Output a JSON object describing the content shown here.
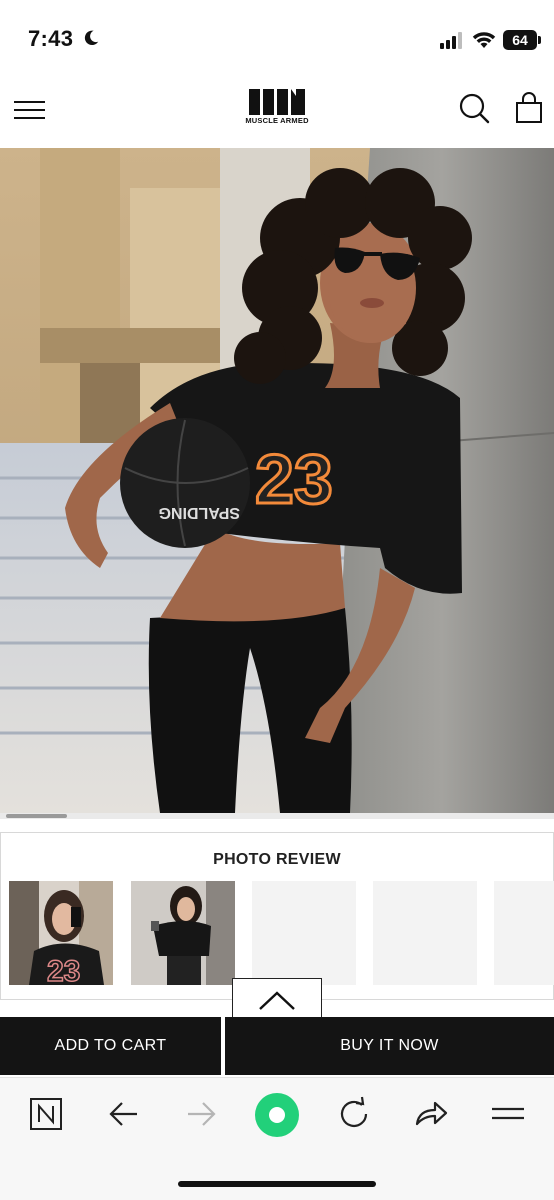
{
  "status_bar": {
    "time": "7:43",
    "battery": "64",
    "icons": [
      "moon-icon",
      "signal-icon",
      "wifi-icon",
      "battery-icon"
    ]
  },
  "header": {
    "brand": "MUSCLE ARMED",
    "icons": [
      "menu-icon",
      "search-icon",
      "shopping-bag-icon"
    ]
  },
  "hero": {
    "jersey_number": "23",
    "ball_text": "SPALDING",
    "image_scroll_progress": 0.11
  },
  "photo_review": {
    "title": "PHOTO REVIEW"
  },
  "buttons": {
    "add_to_cart": "ADD TO CART",
    "buy_now": "BUY IT NOW",
    "scroll_top_icon": "chevron-up-icon"
  },
  "browser_toolbar": {
    "icons": [
      "n-tab-icon",
      "back-arrow-icon",
      "forward-arrow-icon",
      "green-home-icon",
      "reload-icon",
      "share-icon",
      "more-menu-icon"
    ]
  },
  "colors": {
    "primary_button": "#141414",
    "home_button_green": "#22d07a"
  }
}
